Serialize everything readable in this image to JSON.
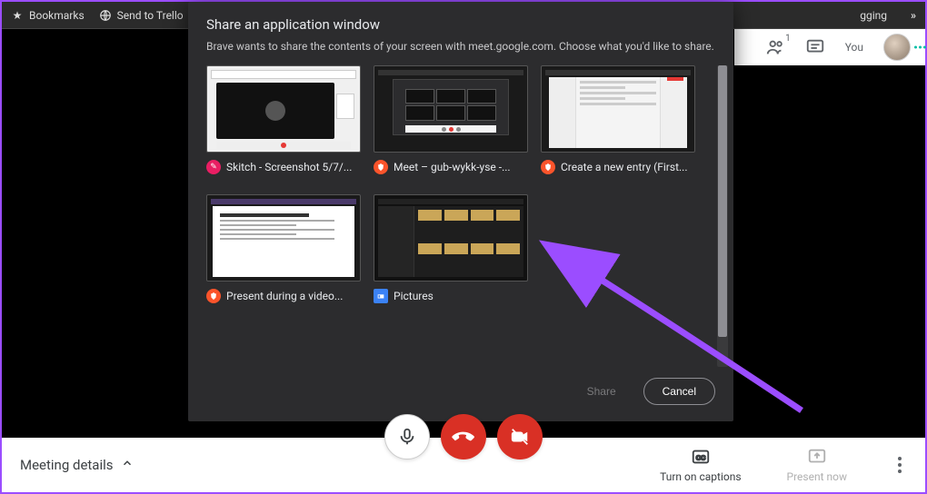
{
  "bookmarks": {
    "items": [
      {
        "label": "Bookmarks",
        "icon": "star"
      },
      {
        "label": "Send to Trello",
        "icon": "globe"
      }
    ],
    "right_label": "gging",
    "overflow": "»"
  },
  "meet_topbar": {
    "people_count": "1",
    "you_label": "You"
  },
  "dialog": {
    "title": "Share an application window",
    "subtitle": "Brave wants to share the contents of your screen with meet.google.com. Choose what you'd like to share.",
    "windows": [
      {
        "label": "Skitch - Screenshot 5/7/...",
        "app": "skitch"
      },
      {
        "label": "Meet – gub-wykk-yse -...",
        "app": "brave"
      },
      {
        "label": "Create a new entry (First...",
        "app": "brave"
      },
      {
        "label": "Present during a video...",
        "app": "brave"
      },
      {
        "label": "Pictures",
        "app": "folder"
      }
    ],
    "share_label": "Share",
    "cancel_label": "Cancel"
  },
  "bottom": {
    "meeting_details": "Meeting details",
    "captions_label": "Turn on captions",
    "present_label": "Present now"
  }
}
